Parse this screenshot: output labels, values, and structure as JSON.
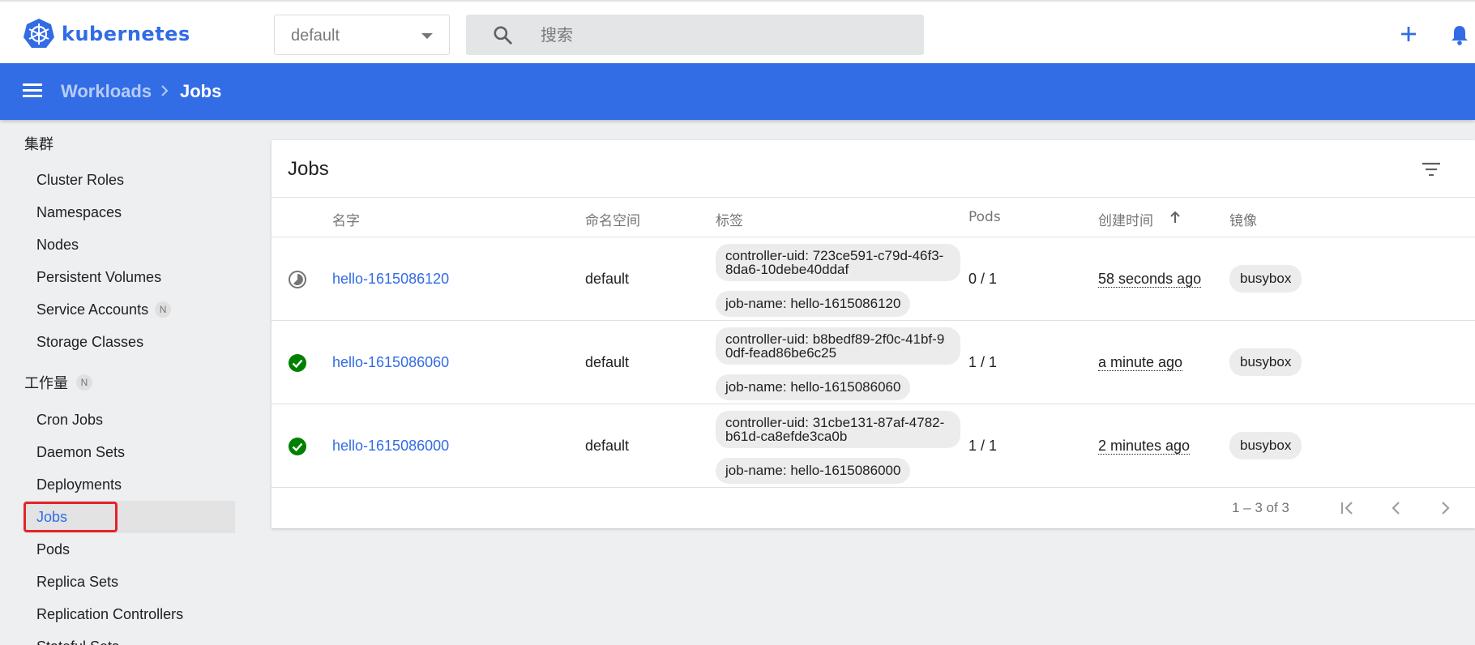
{
  "topbar": {
    "logo_text": "kubernetes",
    "namespace_selected": "default",
    "search_placeholder": "搜索"
  },
  "breadcrumb": {
    "parent": "Workloads",
    "current": "Jobs"
  },
  "sidebar": {
    "cluster_section": "集群",
    "cluster_items": [
      "Cluster Roles",
      "Namespaces",
      "Nodes",
      "Persistent Volumes",
      "Service Accounts",
      "Storage Classes"
    ],
    "service_accounts_badge": "N",
    "workloads_section": "工作量",
    "workloads_badge": "N",
    "workload_items": [
      "Cron Jobs",
      "Daemon Sets",
      "Deployments",
      "Jobs",
      "Pods",
      "Replica Sets",
      "Replication Controllers",
      "Stateful Sets"
    ],
    "active_item": "Jobs"
  },
  "card": {
    "title": "Jobs",
    "columns": [
      "名字",
      "命名空间",
      "标签",
      "Pods",
      "创建时间",
      "镜像"
    ],
    "rows": [
      {
        "status": "running",
        "name": "hello-1615086120",
        "namespace": "default",
        "label_uid": "controller-uid: 723ce591-c79d-46f3-8da6-10debe40ddaf",
        "label_job": "job-name: hello-1615086120",
        "pods": "0 / 1",
        "created": "58 seconds ago",
        "image": "busybox"
      },
      {
        "status": "succeeded",
        "name": "hello-1615086060",
        "namespace": "default",
        "label_uid": "controller-uid: b8bedf89-2f0c-41bf-90df-fead86be6c25",
        "label_job": "job-name: hello-1615086060",
        "pods": "1 / 1",
        "created": "a minute ago",
        "image": "busybox"
      },
      {
        "status": "succeeded",
        "name": "hello-1615086000",
        "namespace": "default",
        "label_uid": "controller-uid: 31cbe131-87af-4782-b61d-ca8efde3ca0b",
        "label_job": "job-name: hello-1615086000",
        "pods": "1 / 1",
        "created": "2 minutes ago",
        "image": "busybox"
      }
    ],
    "pagination": "1 – 3 of 3"
  },
  "colors": {
    "brand_blue": "#326ce5",
    "success_green": "#008000",
    "highlight_red": "#e3242b"
  }
}
